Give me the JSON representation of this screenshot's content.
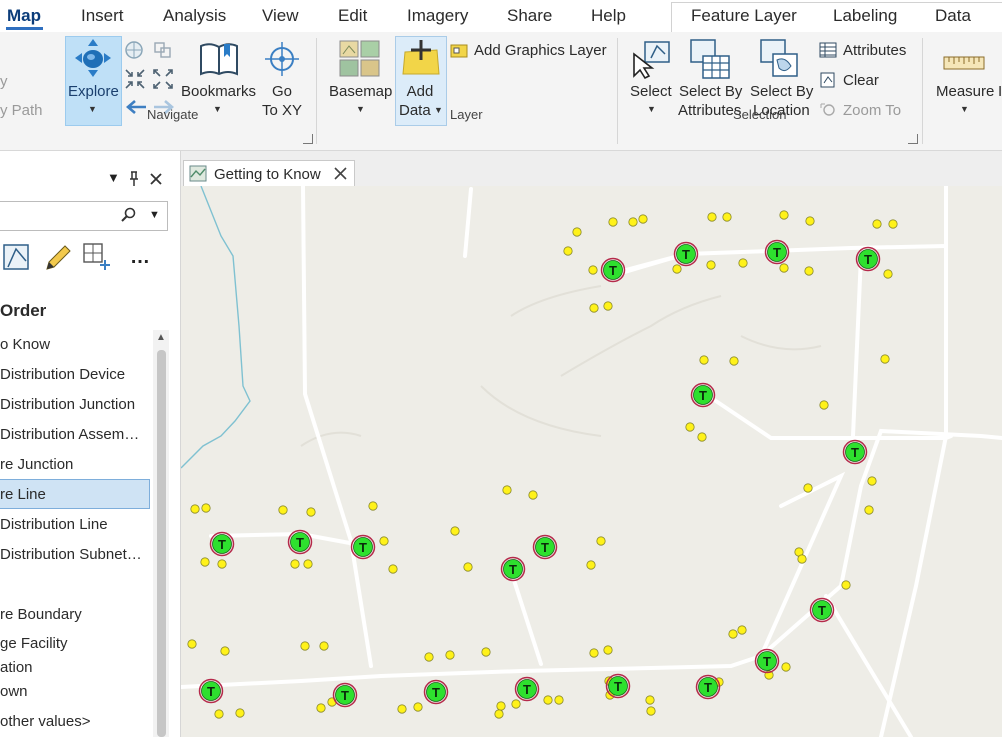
{
  "tabs": [
    "Map",
    "Insert",
    "Analysis",
    "View",
    "Edit",
    "Imagery",
    "Share",
    "Help"
  ],
  "context_tabs": [
    "Feature Layer",
    "Labeling",
    "Data"
  ],
  "ribbon": {
    "cut_left": {
      "line1": "y",
      "line2": "y Path"
    },
    "navigate": {
      "explore": "Explore",
      "bookmarks": "Bookmarks",
      "goto_line1": "Go",
      "goto_line2": "To XY",
      "group": "Navigate"
    },
    "layer": {
      "basemap": "Basemap",
      "add_data_line1": "Add",
      "add_data_line2": "Data",
      "add_graphics": "Add Graphics Layer",
      "group": "Layer"
    },
    "selection": {
      "select": "Select",
      "by_attr_line1": "Select By",
      "by_attr_line2": "Attributes",
      "by_loc_line1": "Select By",
      "by_loc_line2": "Location",
      "attributes": "Attributes",
      "clear": "Clear",
      "zoom_to": "Zoom To",
      "group": "Selection"
    },
    "measure": "Measure",
    "measure_cut": "I"
  },
  "contents": {
    "heading": "Order",
    "items": [
      "o Know",
      "Distribution Device",
      "Distribution Junction",
      "Distribution Assem…",
      "re Junction",
      "re Line",
      "Distribution Line",
      "Distribution Subnet…",
      "re Boundary",
      "ge Facility",
      "ation",
      "own",
      "other values>"
    ]
  },
  "map": {
    "tab_title": "Getting to Know",
    "symbol_letter": "T",
    "colors": {
      "background": "#eeede7",
      "road": "#ffffff",
      "water": "#7fc1d1",
      "point": "#fff21a",
      "transformer": "#2ee02e",
      "transformer_ring": "#b5294a"
    }
  }
}
